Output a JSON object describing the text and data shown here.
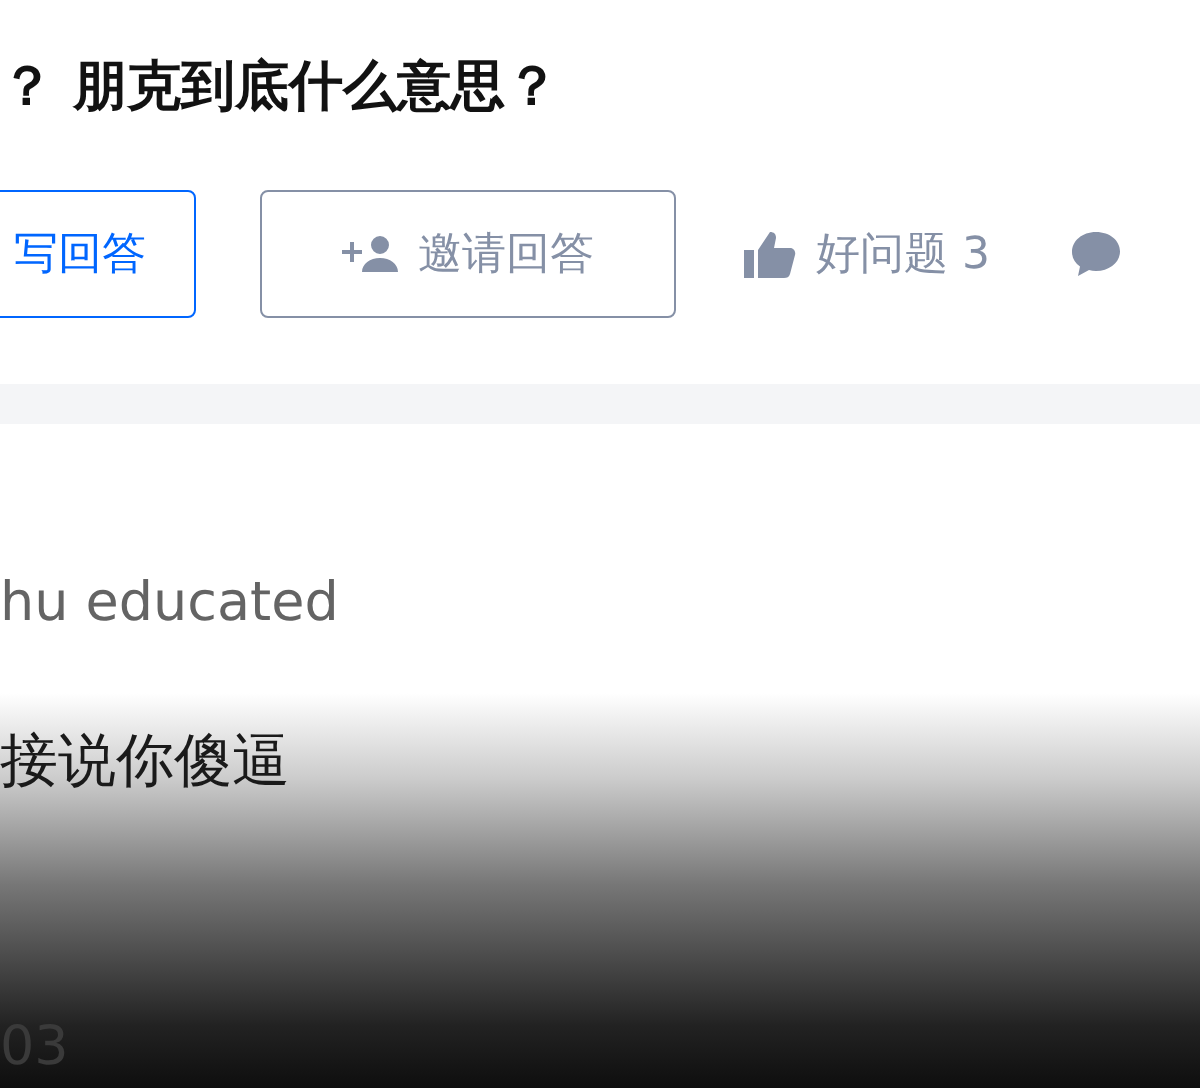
{
  "question": {
    "title": "？ 朋克到底什么意思？"
  },
  "actions": [
    {
      "kind": "primary",
      "label": "写回答"
    },
    {
      "kind": "outline",
      "label": "邀请回答"
    },
    {
      "kind": "like",
      "label": "好问题 3"
    },
    {
      "kind": "comment"
    }
  ],
  "answer": {
    "author_line": "hu educated",
    "text": "接说你傻逼",
    "date": "03"
  }
}
